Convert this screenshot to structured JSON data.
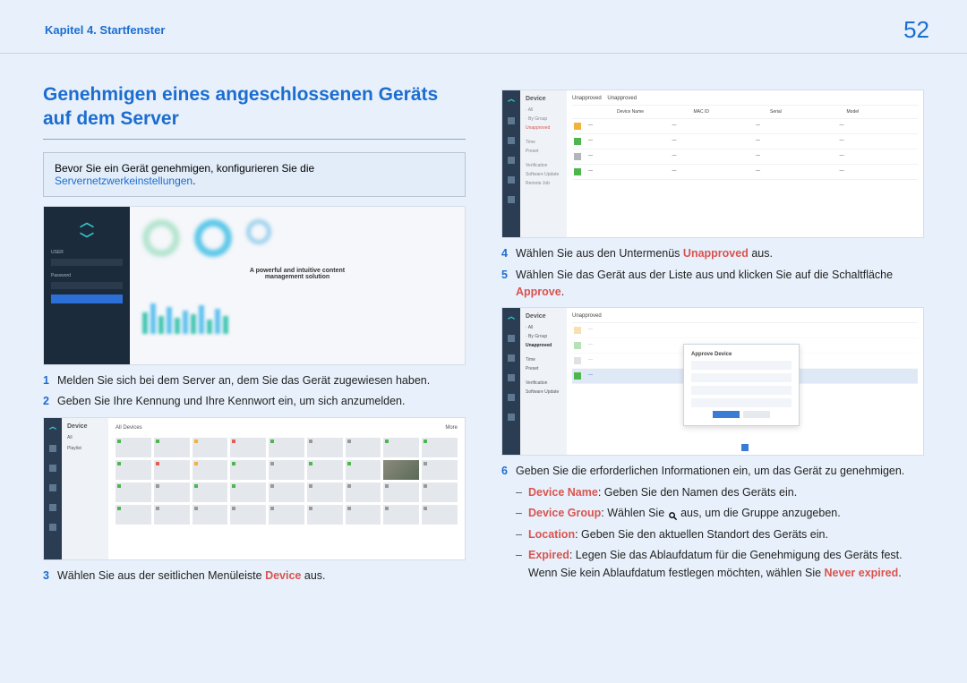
{
  "header": {
    "chapter": "Kapitel 4. Startfenster",
    "page_number": "52"
  },
  "title": "Genehmigen eines angeschlossenen Geräts auf dem Server",
  "info_box": {
    "prefix": "Bevor Sie ein Gerät genehmigen, konfigurieren Sie die ",
    "link": "Servernetzwerkeinstellungen",
    "suffix": "."
  },
  "steps": {
    "s1": {
      "num": "1",
      "text": "Melden Sie sich bei dem Server an, dem Sie das Gerät zugewiesen haben."
    },
    "s2": {
      "num": "2",
      "text": "Geben Sie Ihre Kennung und Ihre Kennwort ein, um sich anzumelden."
    },
    "s3": {
      "num": "3",
      "text_a": "Wählen Sie aus der seitlichen Menüleiste ",
      "red": "Device",
      "text_b": " aus."
    },
    "s4": {
      "num": "4",
      "text_a": "Wählen Sie aus den Untermenüs ",
      "red": "Unapproved",
      "text_b": " aus."
    },
    "s5": {
      "num": "5",
      "text_a": "Wählen Sie das Gerät aus der Liste aus und klicken Sie auf die Schaltfläche ",
      "red": "Approve",
      "text_b": "."
    },
    "s6": {
      "num": "6",
      "text": "Geben Sie die erforderlichen Informationen ein, um das Gerät zu genehmigen."
    }
  },
  "substeps": {
    "a": {
      "dash": "–",
      "label": "Device Name",
      "text": ": Geben Sie den Namen des Geräts ein."
    },
    "b": {
      "dash": "–",
      "label": "Device Group",
      "text_a": ": Wählen Sie ",
      "text_b": " aus, um die Gruppe anzugeben."
    },
    "c": {
      "dash": "–",
      "label": "Location",
      "text": ": Geben Sie den aktuellen Standort des Geräts ein."
    },
    "d": {
      "dash": "–",
      "label": "Expired",
      "text_a": ": Legen Sie das Ablaufdatum für die Genehmigung des Geräts fest. Wenn Sie kein Ablaufdatum festlegen möchten, wählen Sie ",
      "red": "Never expired",
      "text_b": "."
    }
  },
  "fig1": {
    "caption_line1": "A powerful and intuitive content",
    "caption_line2": "management solution"
  },
  "fig2": {
    "title": "Device",
    "tab1": "All Devices",
    "tab2": "More"
  },
  "fig3": {
    "title": "Device",
    "submenu": "Unapproved"
  },
  "fig4": {
    "title": "Device",
    "modal_title": "Approve Device"
  }
}
